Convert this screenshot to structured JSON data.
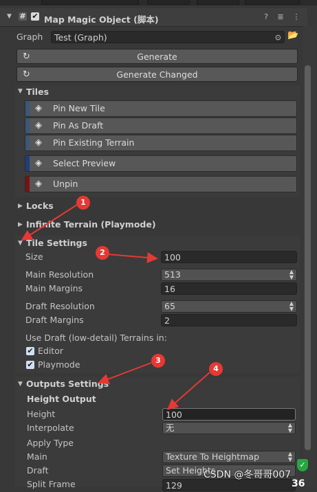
{
  "component": {
    "title": "Map Magic Object  (脚本)",
    "enabled_checkbox_mark": "✔",
    "script_icon_glyph": "#",
    "header_icons": {
      "help": "?",
      "presets": "≣",
      "menu": "⋮"
    }
  },
  "graph": {
    "label": "Graph",
    "value": "Test (Graph)",
    "picker_glyph": "⊙",
    "folder_glyph": "📂"
  },
  "buttons": {
    "generate": "Generate",
    "generate_changed": "Generate Changed",
    "generate_icon": "↻",
    "generate_changed_icon": "↻"
  },
  "tiles": {
    "label": "Tiles",
    "items": [
      {
        "label": "Pin New Tile",
        "color": "#3b5878"
      },
      {
        "label": "Pin As Draft",
        "color": "#3b5878"
      },
      {
        "label": "Pin Existing Terrain",
        "color": "#3b5878"
      },
      {
        "label": "Select Preview",
        "color": "#1f3e7a"
      },
      {
        "label": "Unpin",
        "color": "#7a1212"
      }
    ]
  },
  "foldouts": {
    "locks": "Locks",
    "infinite": "Infinite Terrain (Playmode)"
  },
  "tile_settings": {
    "label": "Tile Settings",
    "size_label": "Size",
    "size_value": "100",
    "main_resolution_label": "Main Resolution",
    "main_resolution_value": "513",
    "main_margins_label": "Main Margins",
    "main_margins_value": "16",
    "draft_resolution_label": "Draft Resolution",
    "draft_resolution_value": "65",
    "draft_margins_label": "Draft Margins",
    "draft_margins_value": "2",
    "use_draft_label": "Use Draft (low-detail) Terrains in:",
    "editor_label": "Editor",
    "playmode_label": "Playmode",
    "editor_checked": true,
    "playmode_checked": true
  },
  "outputs_settings": {
    "label": "Outputs Settings",
    "height_output_label": "Height Output",
    "height_label": "Height",
    "height_value": "100",
    "interpolate_label": "Interpolate",
    "interpolate_value": "无",
    "apply_type_label": "Apply Type",
    "main_label": "Main",
    "main_value": "Texture To Heightmap",
    "draft_label": "Draft",
    "draft_value": "Set Heights",
    "split_frame_label": "Split Frame",
    "split_frame_value": "129"
  },
  "annotations": [
    "1",
    "2",
    "3",
    "4"
  ],
  "overlay": {
    "watermark": "CSDN @冬哥哥007",
    "counter": "36"
  },
  "colors": {
    "annotation": "#e53935",
    "panel": "#383838",
    "field": "#2a2a2a"
  }
}
